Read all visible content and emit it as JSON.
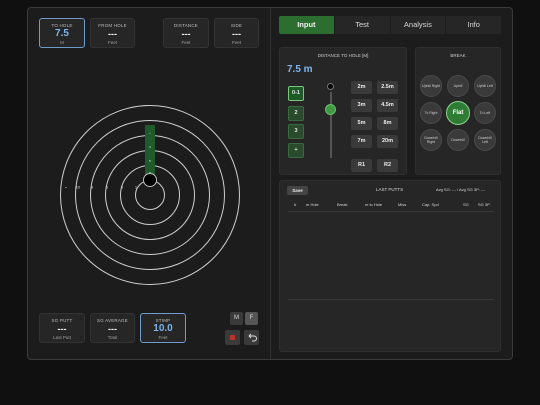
{
  "left": {
    "stats_top": [
      {
        "label": "TO HOLE",
        "value": "7.5",
        "unit": "M",
        "selected": true
      },
      {
        "label": "FROM HOLE",
        "value": "---",
        "unit": "Feet",
        "selected": false
      },
      {
        "label": "DISTANCE",
        "value": "---",
        "unit": "Feet",
        "selected": false
      },
      {
        "label": "SIDE",
        "value": "---",
        "unit": "Feet",
        "selected": false
      }
    ],
    "target_labels": [
      "•",
      "10",
      "8",
      "5",
      "3",
      "1"
    ],
    "fairway_labels": [
      "•",
      "3",
      "5",
      "8"
    ],
    "stats_bottom": [
      {
        "label": "SG PUTT",
        "value": "---",
        "unit": "Last Putt",
        "selected": false
      },
      {
        "label": "SG AVERAGE",
        "value": "---",
        "unit": "Total",
        "selected": false
      },
      {
        "label": "STIMP",
        "value": "10.0",
        "unit": "Feet",
        "selected": true
      }
    ],
    "mf": {
      "m": "M",
      "f": "F"
    },
    "record_color": "#c0312b"
  },
  "tabs": [
    "Input",
    "Test",
    "Analysis",
    "Info"
  ],
  "distance": {
    "title": "DISTANCE TO HOLE [M]",
    "value": "7.5 m",
    "steps": [
      "0-1",
      "2",
      "3",
      "+"
    ],
    "col1": [
      "2m",
      "3m",
      "5m",
      "7m"
    ],
    "col2": [
      "2.5m",
      "4.5m",
      "8m",
      "20m"
    ],
    "r1": "R1",
    "r2": "R2"
  },
  "break": {
    "title": "BREAK",
    "items": [
      "Uphill Right",
      "Uphill",
      "Uphill Left",
      "To Right",
      "Flat",
      "To Left",
      "Downhill Right",
      "Downhill",
      "Downhill Left"
    ],
    "selected": "Flat"
  },
  "putts": {
    "save": "Save",
    "title": "LAST PUTTS",
    "avg": "Avg SG: --- / Avg SG 3P: ---",
    "columns": [
      "#",
      "m Hole",
      "Break",
      "m to Hole",
      "Miss",
      "Cap. Spd",
      "SG",
      "SG 3P"
    ]
  }
}
